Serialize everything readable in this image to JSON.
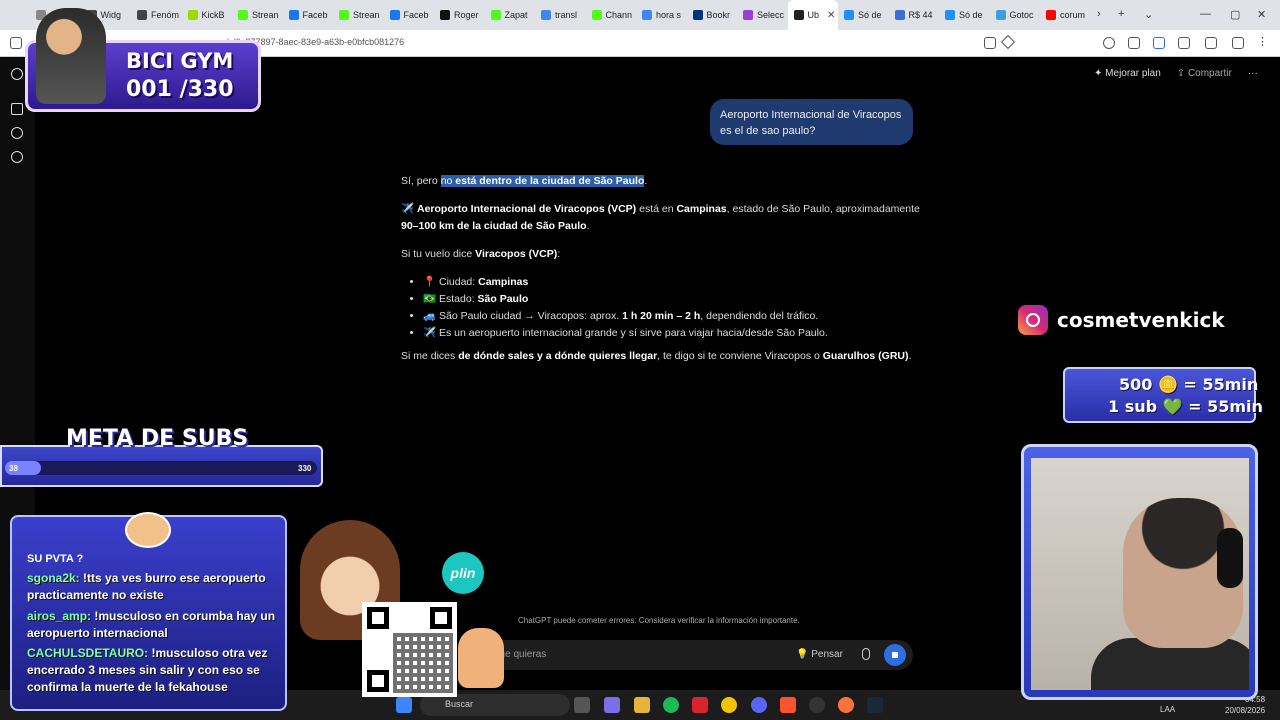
{
  "browser": {
    "tabs": [
      {
        "label": "nb",
        "color": "#888"
      },
      {
        "label": "Widg",
        "color": "#444"
      },
      {
        "label": "Fenóm",
        "color": "#444"
      },
      {
        "label": "KickB",
        "color": "#a3d900"
      },
      {
        "label": "Strean",
        "color": "#53fc18"
      },
      {
        "label": "Faceb",
        "color": "#1877f2"
      },
      {
        "label": "Strean",
        "color": "#53fc18"
      },
      {
        "label": "Faceb",
        "color": "#1877f2"
      },
      {
        "label": "Roger",
        "color": "#111"
      },
      {
        "label": "Zapat",
        "color": "#53fc18"
      },
      {
        "label": "transl",
        "color": "#4285f4"
      },
      {
        "label": "Chann",
        "color": "#53fc18"
      },
      {
        "label": "hora s",
        "color": "#4285f4"
      },
      {
        "label": "Bookr",
        "color": "#003580"
      },
      {
        "label": "Selecc",
        "color": "#9b3dd6"
      },
      {
        "label": "Ub",
        "color": "#222",
        "active": true
      },
      {
        "label": "Só de",
        "color": "#1e90ff"
      },
      {
        "label": "R$ 44",
        "color": "#3b6fd6"
      },
      {
        "label": "Só de",
        "color": "#1e90ff"
      },
      {
        "label": "Gotoc",
        "color": "#3aa0e0"
      },
      {
        "label": "corum",
        "color": "#ff0000"
      }
    ],
    "url": "…com/c/6a877897-8aec-83e9-a63b-e0bfcb081276"
  },
  "chatgpt": {
    "upgrade_label": "Mejorar plan",
    "share_label": "Compartir",
    "user_message": "Aeroporto Internacional de Viracopos es el de sao paulo?",
    "answer": {
      "p1_pre": "Sí, pero ",
      "p1_hl1": "no",
      "p1_hl2": " está dentro de la ciudad de São Paulo",
      "p1_post": ".",
      "p2_icon": "✈️",
      "p2_b1": "Aeroporto Internacional de Viracopos (VCP)",
      "p2_t1": " está en ",
      "p2_b2": "Campinas",
      "p2_t2": ", estado de São Paulo, aproximadamente ",
      "p2_b3": "90–100 km de la ciudad de São Paulo",
      "p2_t3": ".",
      "p3_t": "Si tu vuelo dice ",
      "p3_b": "Viracopos (VCP)",
      "p3_end": ":",
      "li1_icon": "📍",
      "li1_t": " Ciudad: ",
      "li1_b": "Campinas",
      "li2_icon": "🇧🇷",
      "li2_t": " Estado: ",
      "li2_b": "São Paulo",
      "li3_icon": "🚙",
      "li3_t": " São Paulo ciudad → Viracopos: aprox. ",
      "li3_b": "1 h 20 min – 2 h",
      "li3_end": ", dependiendo del tráfico.",
      "li4_icon": "✈️",
      "li4_t": " Es un aeropuerto internacional grande y sí sirve para viajar hacia/desde São Paulo.",
      "p4_t1": "Si me dices ",
      "p4_b1": "de dónde sales y a dónde quieres llegar",
      "p4_t2": ", te digo si te conviene Viracopos o ",
      "p4_b2": "Guarulhos (GRU)",
      "p4_t3": "."
    },
    "disclaimer": "ChatGPT puede cometer errores. Considera verificar la información importante.",
    "composer_placeholder": "que quieras",
    "think_label": "Pensar"
  },
  "taskbar": {
    "search_placeholder": "Buscar",
    "lang": "LAA",
    "time": "04:58",
    "date": "20/08/2026"
  },
  "overlay": {
    "bicigym_title": "BICI GYM",
    "bicigym_count": "001 /330",
    "instagram_handle": "cosmetvenkick",
    "sub_line1": "500 🪙 = 55min",
    "sub_line2": "1 sub 💚 = 55min",
    "meta_title": "META DE SUBS",
    "meta_current": "38",
    "meta_goal": "330",
    "meta_progress": 0.115,
    "plin_label": "plin",
    "chat_header": "SU PVTA ?",
    "chat": [
      {
        "user": "sgona2k:",
        "text": " !tts ya ves burro ese aeropuerto practicamente no existe"
      },
      {
        "user": "airos_amp:",
        "text": " !musculoso en corumba hay un aeropuerto internacional"
      },
      {
        "user": "CACHULSDETAURO:",
        "text": " !musculoso otra vez encerrado 3 meses sin salir y con eso se confirma la muerte de la fekahouse"
      }
    ]
  }
}
